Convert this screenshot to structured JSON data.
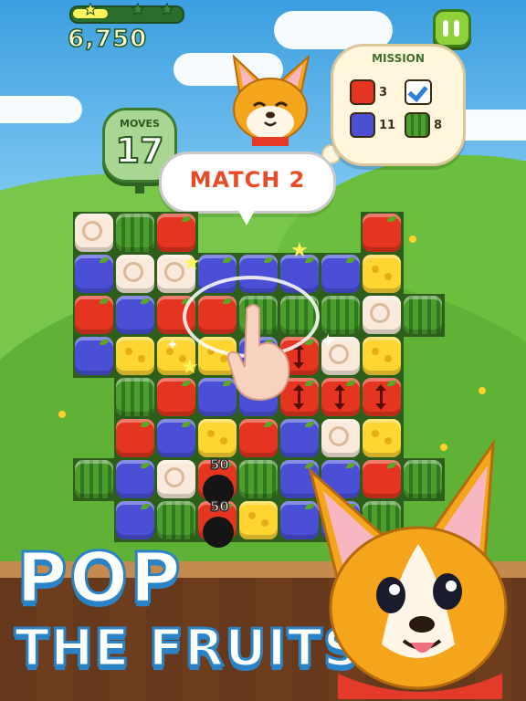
{
  "hud": {
    "score": "6,750",
    "progress": 0.32,
    "stars_earned": 1,
    "stars_total": 3,
    "pause_icon": "pause-icon"
  },
  "moves": {
    "label": "MOVES",
    "value": "17"
  },
  "mission": {
    "title": "MISSION",
    "goals": [
      {
        "fruit": "apple",
        "count": "3",
        "done": false
      },
      {
        "fruit": "roll",
        "count": "",
        "done": true
      },
      {
        "fruit": "plum",
        "count": "11",
        "done": false
      },
      {
        "fruit": "melon",
        "count": "8",
        "done": false
      }
    ]
  },
  "hint": {
    "text": "MATCH 2"
  },
  "board": {
    "rows": [
      [
        "roll",
        "melon",
        "apple",
        null,
        null,
        null,
        null,
        "apple",
        null
      ],
      [
        "plum",
        "roll",
        "roll",
        "plum",
        "plum",
        "plum",
        "plum",
        "cheese",
        null
      ],
      [
        "apple",
        "plum",
        "apple",
        "apple",
        "melon",
        "melon",
        "melon",
        "roll",
        "melon"
      ],
      [
        "plum",
        "cheese",
        "cheese",
        "cheese",
        "plum",
        "apple-arrow",
        "roll",
        "cheese",
        null
      ],
      [
        null,
        "melon",
        "apple",
        "plum",
        "plum",
        "apple-arrow",
        "apple-arrow",
        "apple-arrow",
        null
      ],
      [
        null,
        "apple",
        "plum",
        "cheese",
        "apple",
        "plum",
        "roll",
        "cheese",
        null
      ],
      [
        "melon",
        "plum",
        "roll",
        "apple",
        "melon",
        "plum",
        "plum",
        "apple",
        "melon"
      ],
      [
        null,
        "plum",
        "melon",
        "apple",
        "cheese",
        "plum",
        "plum",
        "melon",
        null
      ]
    ]
  },
  "popups": [
    {
      "points": "50"
    },
    {
      "points": "50"
    }
  ],
  "title": {
    "line1": "POP",
    "line2": "THE FRUITS"
  },
  "colors": {
    "apple": "#e53520",
    "plum": "#4b4fd6",
    "melon": "#3f8f28",
    "cheese": "#ffd532",
    "roll": "#f9eadb",
    "title_outline": "#2b83c7"
  }
}
